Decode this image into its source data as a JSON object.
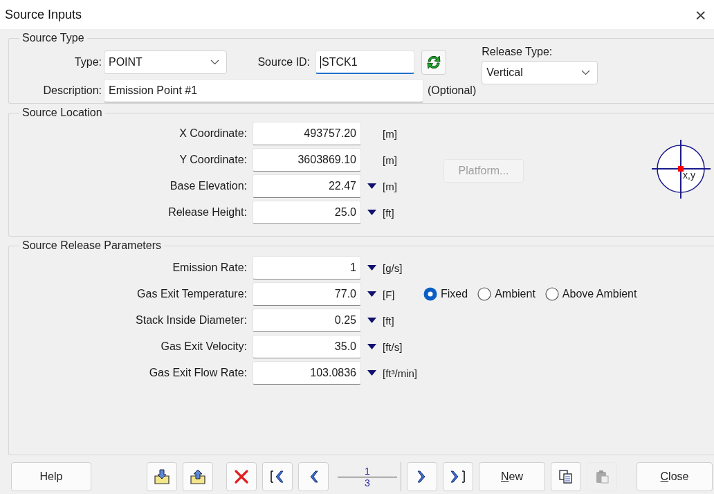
{
  "window": {
    "title": "Source Inputs",
    "close": "×"
  },
  "source_type": {
    "title": "Source Type",
    "type": {
      "label": "Type:",
      "value": "POINT"
    },
    "source_id": {
      "label": "Source ID:",
      "value": "STCK1",
      "focused": true
    },
    "description": {
      "label": "Description:",
      "value": "Emission Point #1",
      "note": "(Optional)"
    },
    "release_type": {
      "label": "Release Type:",
      "value": "Vertical"
    }
  },
  "source_location": {
    "title": "Source Location",
    "fields": [
      {
        "label": "X Coordinate:",
        "value": "493757.20",
        "unit": "[m]",
        "unit_menu": false
      },
      {
        "label": "Y Coordinate:",
        "value": "3603869.10",
        "unit": "[m]",
        "unit_menu": false
      },
      {
        "label": "Base Elevation:",
        "value": "22.47",
        "unit": "[m]",
        "unit_menu": true
      },
      {
        "label": "Release Height:",
        "value": "25.0",
        "unit": "[ft]",
        "unit_menu": true
      }
    ],
    "platform": {
      "label": "Platform...",
      "disabled": true
    },
    "locator": {
      "label": "x,y"
    }
  },
  "release_parameters": {
    "title": "Source Release Parameters",
    "fields": [
      {
        "label": "Emission Rate:",
        "value": "1",
        "unit": "[g/s]",
        "unit_menu": true
      },
      {
        "label": "Gas Exit Temperature:",
        "value": "77.0",
        "unit": "[F]",
        "unit_menu": true,
        "options": [
          {
            "label": "Fixed",
            "selected": true
          },
          {
            "label": "Ambient",
            "selected": false
          },
          {
            "label": "Above Ambient",
            "selected": false
          }
        ]
      },
      {
        "label": "Stack Inside Diameter:",
        "value": "0.25",
        "unit": "[ft]",
        "unit_menu": true
      },
      {
        "label": "Gas Exit Velocity:",
        "value": "35.0",
        "unit": "[ft/s]",
        "unit_menu": true
      },
      {
        "label": "Gas Exit Flow Rate:",
        "value": "103.0836",
        "unit": "[ft³/min]",
        "unit_menu": true
      }
    ]
  },
  "toolbar": {
    "groups": [
      [
        {
          "kind": "text",
          "label": "Help",
          "disabled": false,
          "mnemonic": false
        }
      ],
      [
        {
          "kind": "import",
          "disabled": false
        },
        {
          "kind": "export",
          "disabled": false
        }
      ],
      [
        {
          "kind": "delete",
          "disabled": false
        },
        {
          "kind": "first",
          "disabled": false
        },
        {
          "kind": "prev",
          "disabled": false
        },
        {
          "kind": "pager",
          "current": "1",
          "total": "3"
        },
        {
          "kind": "next",
          "disabled": false
        },
        {
          "kind": "last",
          "disabled": false
        },
        {
          "kind": "text",
          "label": "New",
          "disabled": false,
          "mnemonic": true
        },
        {
          "kind": "copy",
          "disabled": false
        },
        {
          "kind": "paste",
          "disabled": true
        }
      ],
      [
        {
          "kind": "text",
          "label": "Close",
          "disabled": false,
          "mnemonic": true
        }
      ]
    ]
  }
}
